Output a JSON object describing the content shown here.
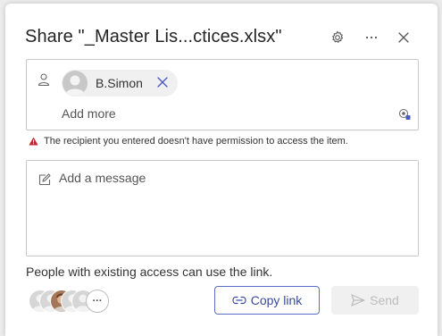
{
  "dialog": {
    "title": "Share \"_Master Lis...ctices.xlsx\"",
    "header_icons": [
      "gear-icon",
      "more-icon",
      "close-icon"
    ]
  },
  "recipients": {
    "chips": [
      {
        "name": "B.Simon"
      }
    ],
    "add_more_placeholder": "Add more"
  },
  "warning": {
    "text": "The recipient you entered doesn't have permission to access the item.",
    "color": "#c4262e"
  },
  "message": {
    "placeholder": "Add a message"
  },
  "footer": {
    "access_text": "People with existing access can use the link.",
    "more_label": "···",
    "copy_link_label": "Copy link",
    "send_label": "Send",
    "accent_color": "#5b6fc8"
  }
}
